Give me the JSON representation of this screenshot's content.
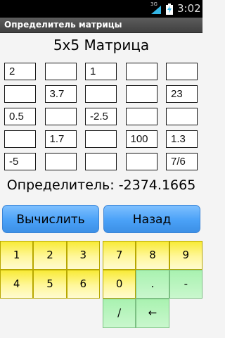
{
  "status": {
    "network": "3G",
    "time": "3:02"
  },
  "app": {
    "title": "Определитель матрицы"
  },
  "heading": "5x5 Матрица",
  "matrix": [
    [
      "2",
      "",
      "1",
      "",
      ""
    ],
    [
      "",
      "3.7",
      "",
      "",
      "23"
    ],
    [
      "0.5",
      "",
      "-2.5",
      "",
      ""
    ],
    [
      "",
      "1.7",
      "",
      "100",
      "1.3"
    ],
    [
      "-5",
      "",
      "",
      "",
      "7/6"
    ]
  ],
  "result": "Определитель: -2374.1665",
  "buttons": {
    "calculate": "Вычислить",
    "back": "Назад"
  },
  "keypad_left": [
    {
      "label": "1",
      "style": "y"
    },
    {
      "label": "2",
      "style": "y"
    },
    {
      "label": "3",
      "style": "y"
    },
    {
      "label": "4",
      "style": "y"
    },
    {
      "label": "5",
      "style": "y"
    },
    {
      "label": "6",
      "style": "y"
    }
  ],
  "keypad_right": [
    {
      "label": "7",
      "style": "y"
    },
    {
      "label": "8",
      "style": "y"
    },
    {
      "label": "9",
      "style": "y"
    },
    {
      "label": "0",
      "style": "y"
    },
    {
      "label": ".",
      "style": "g"
    },
    {
      "label": "-",
      "style": "g"
    },
    {
      "label": "/",
      "style": "g"
    },
    {
      "label": "←",
      "style": "g"
    },
    {
      "label": "",
      "style": "empty"
    }
  ],
  "colors": {
    "button_blue": "#4aa1f7",
    "key_yellow": "#f8ea36",
    "key_green": "#a9f2b0",
    "titlebar": "#404040"
  }
}
